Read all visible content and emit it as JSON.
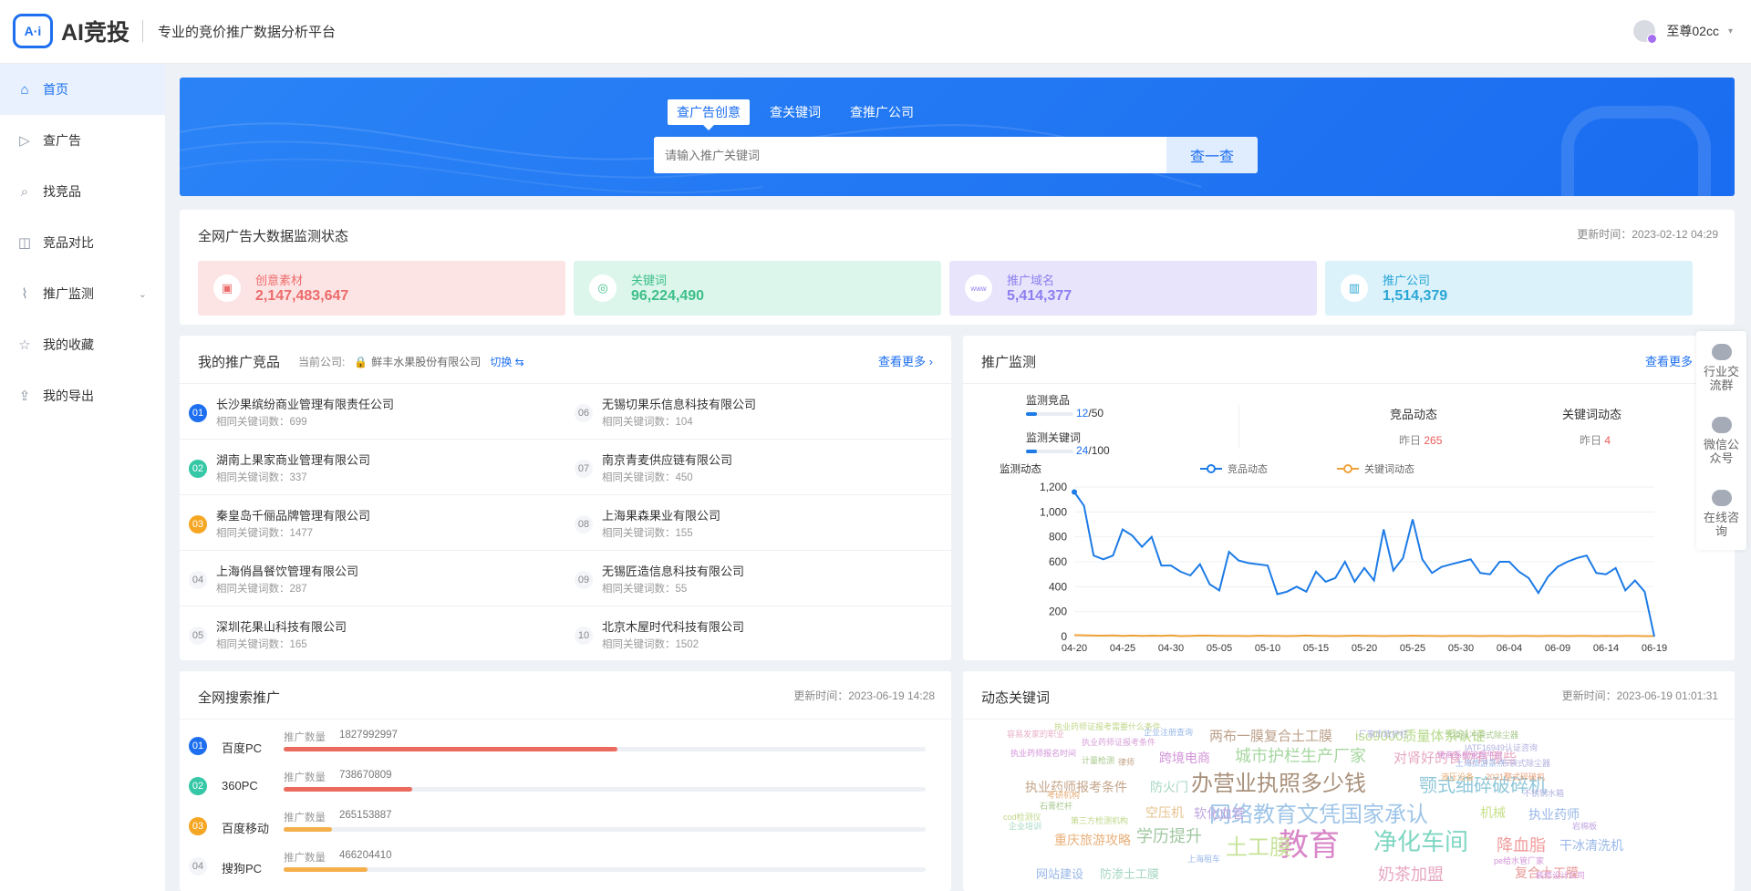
{
  "brand": {
    "logo_mark": "A·i",
    "name": "AI竞投",
    "slogan": "专业的竞价推广数据分析平台"
  },
  "user": {
    "name": "至尊02cc"
  },
  "sidebar": {
    "items": [
      {
        "label": "首页",
        "icon": "home-icon",
        "active": true
      },
      {
        "label": "查广告",
        "icon": "play-icon"
      },
      {
        "label": "找竞品",
        "icon": "search-list-icon"
      },
      {
        "label": "竞品对比",
        "icon": "compare-icon"
      },
      {
        "label": "推广监测",
        "icon": "monitor-icon",
        "has_children": true
      },
      {
        "label": "我的收藏",
        "icon": "star-icon"
      },
      {
        "label": "我的导出",
        "icon": "export-icon"
      }
    ]
  },
  "hero": {
    "tabs": [
      "查广告创意",
      "查关键词",
      "查推广公司"
    ],
    "active_tab": 0,
    "search_placeholder": "请输入推广关键词",
    "search_button": "查一查"
  },
  "monitor_status": {
    "title": "全网广告大数据监测状态",
    "update_time": "更新时间：2023-02-12 04:29",
    "stats": [
      {
        "label": "创意素材",
        "value": "2,147,483,647",
        "bg": "#fde4e4",
        "color": "#ec6b6b",
        "icon": "image-icon"
      },
      {
        "label": "关键词",
        "value": "96,224,490",
        "bg": "#dcf6ec",
        "color": "#3dbf88",
        "icon": "target-icon"
      },
      {
        "label": "推广域名",
        "value": "5,414,377",
        "bg": "#e7e4fb",
        "color": "#8d7ff0",
        "icon": "www-icon"
      },
      {
        "label": "推广公司",
        "value": "1,514,379",
        "bg": "#dcf2fb",
        "color": "#2aa6d6",
        "icon": "building-icon"
      }
    ]
  },
  "my_products": {
    "title": "我的推广竞品",
    "company_label": "当前公司:",
    "company_name": "鲜丰水果股份有限公司",
    "switch_label": "切换 ⇆",
    "more_label": "查看更多 ›",
    "items": [
      {
        "rank": "01",
        "name": "长沙果缤纷商业管理有限责任公司",
        "sub": "相同关键词数：699"
      },
      {
        "rank": "02",
        "name": "湖南上果家商业管理有限公司",
        "sub": "相同关键词数：337"
      },
      {
        "rank": "03",
        "name": "秦皇岛千俪品牌管理有限公司",
        "sub": "相同关键词数：1477"
      },
      {
        "rank": "04",
        "name": "上海俏昌餐饮管理有限公司",
        "sub": "相同关键词数：287"
      },
      {
        "rank": "05",
        "name": "深圳花果山科技有限公司",
        "sub": "相同关键词数：165"
      },
      {
        "rank": "06",
        "name": "无锡切果乐信息科技有限公司",
        "sub": "相同关键词数：104"
      },
      {
        "rank": "07",
        "name": "南京青麦供应链有限公司",
        "sub": "相同关键词数：450"
      },
      {
        "rank": "08",
        "name": "上海果森果业有限公司",
        "sub": "相同关键词数：155"
      },
      {
        "rank": "09",
        "name": "无锡匠造信息科技有限公司",
        "sub": "相同关键词数：55"
      },
      {
        "rank": "10",
        "name": "北京木屋时代科技有限公司",
        "sub": "相同关键词数：1502"
      }
    ],
    "rank_colors": {
      "01": "#1d6ff0",
      "02": "#35c7a6",
      "03": "#f5a623"
    }
  },
  "promo_monitor": {
    "title": "推广监测",
    "more_label": "查看更多",
    "competitor_label": "监测竞品",
    "competitor_count": "12",
    "competitor_total": "/50",
    "competitor_fraction": 0.24,
    "keyword_label": "监测关键词",
    "keyword_count": "24",
    "keyword_total": "/100",
    "keyword_fraction": 0.24,
    "comp_dyn_label": "竞品动态",
    "comp_dyn_prefix": "昨日",
    "comp_dyn_value": "265",
    "kw_dyn_label": "关键词动态",
    "kw_dyn_prefix": "昨日",
    "kw_dyn_value": "4"
  },
  "chart_data": {
    "type": "line",
    "title": "监测动态",
    "legend_placement": "top-center",
    "x_ticks": [
      "04-20",
      "04-25",
      "04-30",
      "05-05",
      "05-10",
      "05-15",
      "05-20",
      "05-25",
      "05-30",
      "06-04",
      "06-09",
      "06-14",
      "06-19"
    ],
    "y_ticks": [
      "0",
      "200",
      "400",
      "600",
      "800",
      "1,000",
      "1,200"
    ],
    "ylim": [
      0,
      1200
    ],
    "grid": "horizontal",
    "x_count": 61,
    "series": [
      {
        "name": "竞品动态",
        "color": "#1d7be6",
        "values": [
          1160,
          1050,
          650,
          620,
          650,
          860,
          810,
          720,
          800,
          570,
          570,
          520,
          490,
          580,
          420,
          370,
          680,
          610,
          590,
          580,
          570,
          340,
          360,
          400,
          360,
          520,
          440,
          470,
          600,
          440,
          550,
          450,
          860,
          530,
          630,
          940,
          620,
          510,
          560,
          580,
          600,
          620,
          510,
          500,
          600,
          600,
          520,
          470,
          350,
          480,
          560,
          600,
          630,
          650,
          510,
          500,
          550,
          370,
          450,
          360,
          0
        ],
        "marker_values": [
          {
            "x": "04-20",
            "y": 1160
          }
        ]
      },
      {
        "name": "关键词动态",
        "color": "#f0a23a",
        "values": [
          12,
          10,
          8,
          7,
          9,
          6,
          8,
          5,
          7,
          6,
          9,
          4,
          6,
          8,
          7,
          5,
          6,
          5,
          4,
          7,
          6,
          5,
          4,
          6,
          8,
          5,
          6,
          4,
          5,
          7,
          6,
          5,
          4,
          6,
          5,
          7,
          6,
          5,
          4,
          5,
          6,
          5,
          4,
          6,
          5,
          4,
          6,
          5,
          4,
          5,
          6,
          4,
          5,
          6,
          4,
          5,
          4,
          5,
          6,
          4,
          4
        ]
      }
    ]
  },
  "search_promo": {
    "title": "全网搜索推广",
    "update_time": "更新时间：2023-06-19 14:28",
    "count_label": "推广数量",
    "items": [
      {
        "rank": "01",
        "name": "百度PC",
        "value": "1827992997",
        "fraction": 0.52,
        "color": "#ec6b5e"
      },
      {
        "rank": "02",
        "name": "360PC",
        "value": "738670809",
        "fraction": 0.2,
        "color": "#ec6b5e"
      },
      {
        "rank": "03",
        "name": "百度移动",
        "value": "265153887",
        "fraction": 0.075,
        "color": "#f5b04c"
      },
      {
        "rank": "04",
        "name": "搜狗PC",
        "value": "466204410",
        "fraction": 0.13,
        "color": "#f5b04c"
      }
    ]
  },
  "dynamic_keywords": {
    "title": "动态关键词",
    "update_time": "更新时间：2023-06-19 01:01:31",
    "words": [
      {
        "t": "教育",
        "s": 34,
        "c": "#d986c8"
      },
      {
        "t": "办营业执照多少钱",
        "s": 24,
        "c": "#a8907a"
      },
      {
        "t": "网络教育文凭国家承认",
        "s": 24,
        "c": "#9fc5e8"
      },
      {
        "t": "净化车间",
        "s": 26,
        "c": "#7fd6c2"
      },
      {
        "t": "土工膜",
        "s": 24,
        "c": "#c7e39a"
      },
      {
        "t": "颚式细碎破碎机",
        "s": 20,
        "c": "#8fc7d9"
      },
      {
        "t": "城市护栏生产厂家",
        "s": 18,
        "c": "#a6d7a0"
      },
      {
        "t": "学历提升",
        "s": 18,
        "c": "#a0c7a0"
      },
      {
        "t": "降血脂",
        "s": 18,
        "c": "#f29b9b"
      },
      {
        "t": "两布一膜复合土工膜",
        "s": 15,
        "c": "#bca08a"
      },
      {
        "t": "iso9000质量体系认证",
        "s": 15,
        "c": "#b7d98a"
      },
      {
        "t": "对肾好的食物有哪些",
        "s": 15,
        "c": "#e8a7c2"
      },
      {
        "t": "跨境电商",
        "s": 14,
        "c": "#d394d9"
      },
      {
        "t": "执业药师报考条件",
        "s": 14,
        "c": "#c5a58a"
      },
      {
        "t": "防火门",
        "s": 14,
        "c": "#a6d7c2"
      },
      {
        "t": "空压机",
        "s": 14,
        "c": "#e6c38f"
      },
      {
        "t": "软化血管",
        "s": 14,
        "c": "#c1a6e0"
      },
      {
        "t": "机械",
        "s": 14,
        "c": "#c7e08a"
      },
      {
        "t": "执业药师",
        "s": 14,
        "c": "#9ab8e8"
      },
      {
        "t": "重庆旅游攻略",
        "s": 14,
        "c": "#e8b07a"
      },
      {
        "t": "干冰清洗机",
        "s": 14,
        "c": "#9ab8e8"
      },
      {
        "t": "奶茶加盟",
        "s": 18,
        "c": "#e8a7c2"
      },
      {
        "t": "复合土工膜",
        "s": 14,
        "c": "#e89a9a"
      },
      {
        "t": "网站建设",
        "s": 13,
        "c": "#9ab8e8"
      },
      {
        "t": "防渗土工膜",
        "s": 13,
        "c": "#a6d7c2"
      },
      {
        "t": "执业药师证报考需要什么条件",
        "s": 9,
        "c": "#c1d78a"
      },
      {
        "t": "企业注册查询",
        "s": 9,
        "c": "#9ab8e8"
      },
      {
        "t": "容易发家的职业",
        "s": 9,
        "c": "#e8b0c8"
      },
      {
        "t": "执业药师证报考条件",
        "s": 9,
        "c": "#d8a0d8"
      },
      {
        "t": "厂家市政护栏",
        "s": 9,
        "c": "#b0b0e0"
      },
      {
        "t": "气膜脉冲袋式除尘器",
        "s": 9,
        "c": "#a6c78a"
      },
      {
        "t": "执业药师报名时间",
        "s": 9,
        "c": "#d394d9"
      },
      {
        "t": "IATF16949认证咨询",
        "s": 9,
        "c": "#b0b0e0"
      },
      {
        "t": "电商系统管理平台",
        "s": 9,
        "c": "#d394d9"
      },
      {
        "t": "上海旅游景点",
        "s": 9,
        "c": "#9ab8e8"
      },
      {
        "t": "布袋式除尘器",
        "s": 9,
        "c": "#b0b0e0"
      },
      {
        "t": "液压设备",
        "s": 9,
        "c": "#e8b07a"
      },
      {
        "t": "2021整式碎破机",
        "s": 9,
        "c": "#e8a07a"
      },
      {
        "t": "计量检测",
        "s": 9,
        "c": "#a6c78a"
      },
      {
        "t": "律师",
        "s": 9,
        "c": "#c5a58a"
      },
      {
        "t": "不锈钢水箱",
        "s": 9,
        "c": "#b0b0e0"
      },
      {
        "t": "考研机构",
        "s": 9,
        "c": "#e8b07a"
      },
      {
        "t": "石膏栏杆",
        "s": 9,
        "c": "#a6c78a"
      },
      {
        "t": "cod检测仪",
        "s": 9,
        "c": "#c1d78a"
      },
      {
        "t": "企业培训",
        "s": 9,
        "c": "#a6d7c2"
      },
      {
        "t": "第三方检测机构",
        "s": 9,
        "c": "#c1d78a"
      },
      {
        "t": "上海租车",
        "s": 9,
        "c": "#9ab8e8"
      },
      {
        "t": "pe给水管厂家",
        "s": 9,
        "c": "#d394d9"
      },
      {
        "t": "岩棉板",
        "s": 9,
        "c": "#c1a6e0"
      },
      {
        "t": "装修设计公司",
        "s": 9,
        "c": "#d394d9"
      }
    ]
  },
  "float_bar": {
    "items": [
      {
        "label": "行业交流群",
        "icon": "group-chat-icon"
      },
      {
        "label": "微信公众号",
        "icon": "wechat-icon"
      },
      {
        "label": "在线咨询",
        "icon": "consult-icon"
      }
    ]
  }
}
